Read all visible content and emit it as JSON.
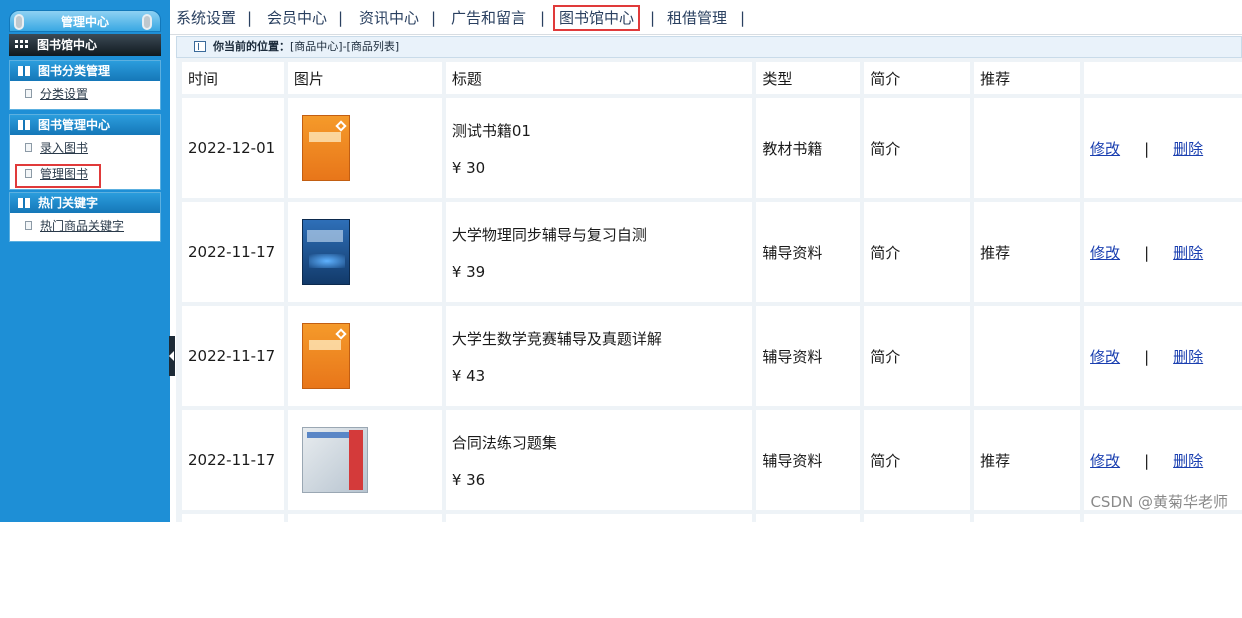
{
  "sidebar": {
    "header": "管理中心",
    "root": "图书馆中心",
    "panels": [
      {
        "title": "图书分类管理",
        "items": [
          "分类设置"
        ]
      },
      {
        "title": "图书管理中心",
        "items": [
          "录入图书",
          "管理图书"
        ]
      },
      {
        "title": "热门关键字",
        "items": [
          "热门商品关键字"
        ]
      }
    ]
  },
  "topnav": {
    "items": [
      "系统设置",
      "会员中心",
      "资讯中心",
      "广告和留言",
      "图书馆中心",
      "租借管理"
    ],
    "separator": "|",
    "active": "图书馆中心"
  },
  "breadcrumb": {
    "label": "你当前的位置：",
    "path": "[商品中心]-[商品列表]"
  },
  "table": {
    "headers": [
      "时间",
      "图片",
      "标题",
      "类型",
      "简介",
      "推荐",
      ""
    ],
    "edit_label": "修改",
    "delete_label": "删除",
    "action_separator": "|",
    "rows": [
      {
        "time": "2022-12-01",
        "title": "测试书籍01",
        "price": "¥ 30",
        "type": "教材书籍",
        "intro": "简介",
        "recommend": "",
        "thumb": "orange-book-cover"
      },
      {
        "time": "2022-11-17",
        "title": "大学物理同步辅导与复习自测",
        "price": "¥ 39",
        "type": "辅导资料",
        "intro": "简介",
        "recommend": "推荐",
        "thumb": "blue-book-cover"
      },
      {
        "time": "2022-11-17",
        "title": "大学生数学竞赛辅导及真题详解",
        "price": "¥ 43",
        "type": "辅导资料",
        "intro": "简介",
        "recommend": "",
        "thumb": "orange-book-cover"
      },
      {
        "time": "2022-11-17",
        "title": "合同法练习题集",
        "price": "¥ 36",
        "type": "辅导资料",
        "intro": "简介",
        "recommend": "推荐",
        "thumb": "grey-book-cover"
      }
    ]
  },
  "watermark": "CSDN @黄菊华老师"
}
